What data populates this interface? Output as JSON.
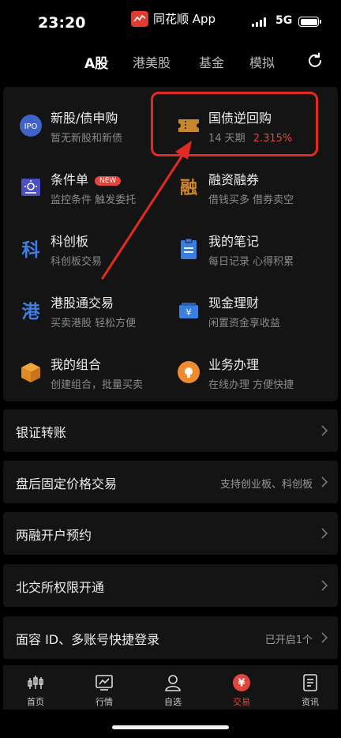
{
  "status_bar": {
    "time": "23:20",
    "app_name": "同花顺 App",
    "network": "5G"
  },
  "tabs": [
    {
      "label": "A股",
      "active": true
    },
    {
      "label": "港美股",
      "active": false
    },
    {
      "label": "基金",
      "active": false
    },
    {
      "label": "模拟",
      "active": false
    }
  ],
  "grid": {
    "ipo": {
      "title": "新股/债申购",
      "sub": "暂无新股和新债",
      "icon_text": "IPO"
    },
    "repo": {
      "title": "国债逆回购",
      "sub_prefix": "14 天期",
      "rate": "2.315%"
    },
    "conditional": {
      "title": "条件单",
      "badge": "NEW",
      "sub": "监控条件 触发委托"
    },
    "margin": {
      "title": "融资融券",
      "sub": "借钱买多 借券卖空",
      "icon_text": "融"
    },
    "star": {
      "title": "科创板",
      "sub": "科创板交易",
      "icon_text": "科"
    },
    "notes": {
      "title": "我的笔记",
      "sub": "每日记录 心得积累"
    },
    "hk_connect": {
      "title": "港股通交易",
      "sub": "买卖港股 轻松方便",
      "icon_text": "港"
    },
    "cash": {
      "title": "现金理财",
      "sub": "闲置资金享收益"
    },
    "portfolio": {
      "title": "我的组合",
      "sub": "创建组合，批量买卖"
    },
    "service": {
      "title": "业务办理",
      "sub": "在线办理 方便快捷"
    }
  },
  "rows": [
    {
      "label": "银证转账",
      "hint": ""
    },
    {
      "label": "盘后固定价格交易",
      "hint": "支持创业板、科创板"
    },
    {
      "label": "两融开户预约",
      "hint": ""
    },
    {
      "label": "北交所权限开通",
      "hint": ""
    },
    {
      "label": "面容 ID、多账号快捷登录",
      "hint": "已开启1个"
    }
  ],
  "bottom_nav": [
    {
      "label": "首页"
    },
    {
      "label": "行情"
    },
    {
      "label": "自选"
    },
    {
      "label": "交易",
      "icon_text": "¥",
      "active": true
    },
    {
      "label": "资讯"
    }
  ],
  "colors": {
    "accent_red": "#e2453c",
    "background": "#000000",
    "card": "#141414"
  }
}
